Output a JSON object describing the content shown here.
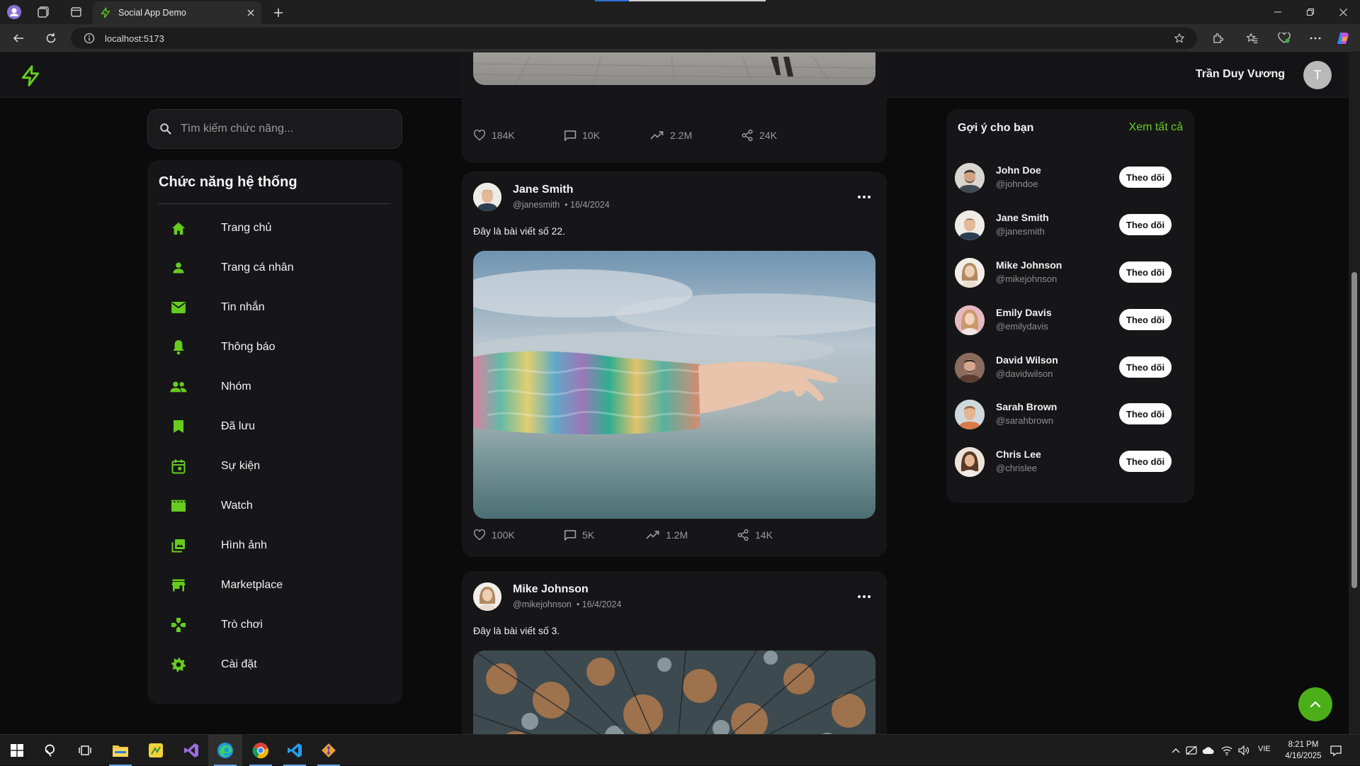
{
  "browser": {
    "tab_title": "Social App Demo",
    "url": "localhost:5173"
  },
  "header": {
    "user_name": "Trần Duy Vương",
    "avatar_letter": "T"
  },
  "search": {
    "placeholder": "Tìm kiếm chức năng..."
  },
  "sidebar": {
    "title": "Chức năng hệ thống",
    "items": [
      {
        "label": "Trang chủ",
        "icon": "home-icon"
      },
      {
        "label": "Trang cá nhân",
        "icon": "person-icon"
      },
      {
        "label": "Tin nhắn",
        "icon": "mail-icon"
      },
      {
        "label": "Thông báo",
        "icon": "bell-icon"
      },
      {
        "label": "Nhóm",
        "icon": "group-icon"
      },
      {
        "label": "Đã lưu",
        "icon": "bookmark-icon"
      },
      {
        "label": "Sự kiện",
        "icon": "calendar-icon"
      },
      {
        "label": "Watch",
        "icon": "movie-icon"
      },
      {
        "label": "Hình ảnh",
        "icon": "photo-library-icon"
      },
      {
        "label": "Marketplace",
        "icon": "store-icon"
      },
      {
        "label": "Trò chơi",
        "icon": "gamepad-icon"
      },
      {
        "label": "Cài đặt",
        "icon": "gear-icon"
      }
    ]
  },
  "posts": [
    {
      "likes": "184K",
      "comments": "10K",
      "views": "2.2M",
      "shares": "24K"
    },
    {
      "author": "Jane Smith",
      "handle": "@janesmith",
      "date": "• 16/4/2024",
      "text": "Đây là bài viết số 22.",
      "likes": "100K",
      "comments": "5K",
      "views": "1.2M",
      "shares": "14K"
    },
    {
      "author": "Mike Johnson",
      "handle": "@mikejohnson",
      "date": "• 16/4/2024",
      "text": "Đây là bài viết số 3."
    }
  ],
  "suggestions": {
    "title": "Gợi ý cho bạn",
    "see_all": "Xem tất cả",
    "follow_label": "Theo dõi",
    "users": [
      {
        "name": "John Doe",
        "handle": "@johndoe"
      },
      {
        "name": "Jane Smith",
        "handle": "@janesmith"
      },
      {
        "name": "Mike Johnson",
        "handle": "@mikejohnson"
      },
      {
        "name": "Emily Davis",
        "handle": "@emilydavis"
      },
      {
        "name": "David Wilson",
        "handle": "@davidwilson"
      },
      {
        "name": "Sarah Brown",
        "handle": "@sarahbrown"
      },
      {
        "name": "Chris Lee",
        "handle": "@chrislee"
      }
    ]
  },
  "taskbar": {
    "lang": "VIE",
    "time": "8:21 PM",
    "date": "4/16/2025"
  },
  "colors": {
    "accent": "#66cc1f",
    "background": "#0b0b0c",
    "card": "#161618"
  }
}
